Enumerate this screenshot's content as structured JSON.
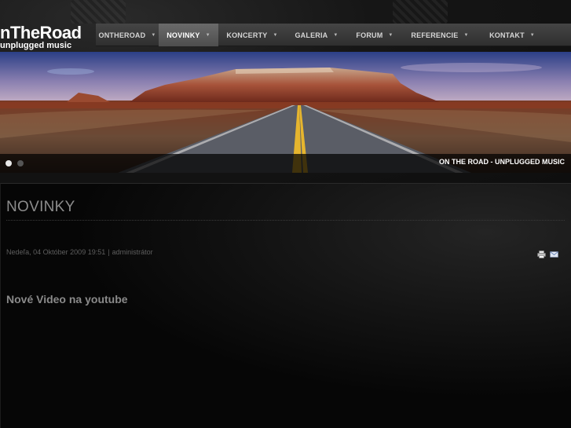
{
  "brand": {
    "logo_main": "nTheRoad",
    "logo_sub": "unplugged music"
  },
  "nav": {
    "items": [
      {
        "label": "ONTHEROAD",
        "active": false
      },
      {
        "label": "NOVINKY",
        "active": true
      },
      {
        "label": "KONCERTY",
        "active": false
      },
      {
        "label": "GALERIA",
        "active": false
      },
      {
        "label": "FORUM",
        "active": false
      },
      {
        "label": "REFERENCIE",
        "active": false
      },
      {
        "label": "KONTAKT",
        "active": false
      }
    ],
    "caret": "▼"
  },
  "banner": {
    "caption": "ON THE ROAD - UNPLUGGED MUSIC",
    "slides": 2,
    "active_slide": 1
  },
  "page": {
    "title": "NOVINKY"
  },
  "article": {
    "date": "Nedeľa, 04 Október 2009 19:51",
    "separator": "|",
    "author": "administrátor",
    "title": "Nové Video na youtube",
    "icons": [
      "print-icon",
      "email-icon"
    ]
  },
  "colors": {
    "nav_bg": "#3a3a3a",
    "nav_active": "#5a5a5a",
    "page_bg": "#0b0b0b",
    "title_text": "#8c8c8c"
  }
}
